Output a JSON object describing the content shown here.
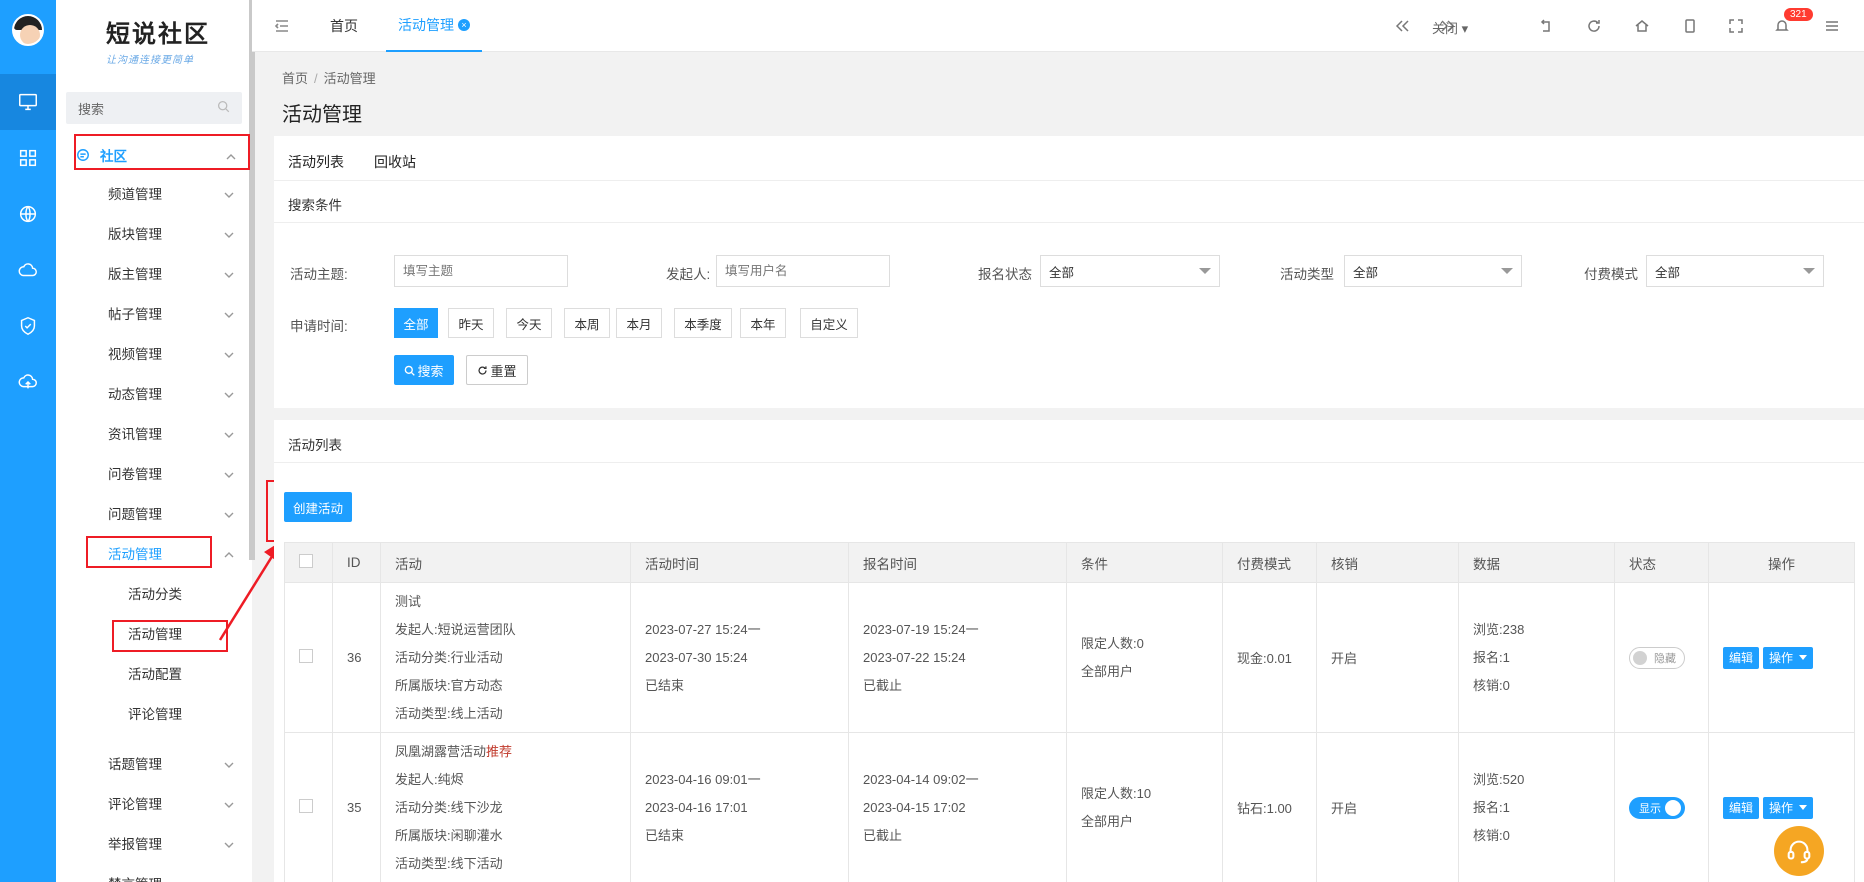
{
  "brand": {
    "title": "短说社区",
    "tagline": "让沟通连接更简单"
  },
  "sidebar": {
    "search_placeholder": "搜索",
    "top_menu": "社区",
    "items": [
      {
        "label": "频道管理"
      },
      {
        "label": "版块管理"
      },
      {
        "label": "版主管理"
      },
      {
        "label": "帖子管理"
      },
      {
        "label": "视频管理"
      },
      {
        "label": "动态管理"
      },
      {
        "label": "资讯管理"
      },
      {
        "label": "问卷管理"
      },
      {
        "label": "问题管理"
      },
      {
        "label": "活动管理"
      }
    ],
    "sub_items": [
      {
        "label": "活动分类"
      },
      {
        "label": "活动管理"
      },
      {
        "label": "活动配置"
      },
      {
        "label": "评论管理"
      }
    ],
    "more_items": [
      {
        "label": "话题管理"
      },
      {
        "label": "评论管理"
      },
      {
        "label": "举报管理"
      },
      {
        "label": "禁言管理"
      }
    ]
  },
  "topbar": {
    "tabs": [
      {
        "label": "首页"
      },
      {
        "label": "活动管理"
      }
    ],
    "close_label": "关闭",
    "notification_count": "321"
  },
  "breadcrumb": {
    "home": "首页",
    "sep": "/",
    "current": "活动管理"
  },
  "page_title": "活动管理",
  "content_tabs": [
    {
      "label": "活动列表"
    },
    {
      "label": "回收站"
    }
  ],
  "search_panel": {
    "title": "搜索条件",
    "topic_label": "活动主题:",
    "topic_placeholder": "填写主题",
    "initiator_label": "发起人:",
    "initiator_placeholder": "填写用户名",
    "signup_label": "报名状态",
    "signup_value": "全部",
    "type_label": "活动类型",
    "type_value": "全部",
    "pay_label": "付费模式",
    "pay_value": "全部",
    "time_label": "申请时间:",
    "time_options": [
      {
        "label": "全部"
      },
      {
        "label": "昨天"
      },
      {
        "label": "今天"
      },
      {
        "label": "本周"
      },
      {
        "label": "本月"
      },
      {
        "label": "本季度"
      },
      {
        "label": "本年"
      },
      {
        "label": "自定义"
      }
    ],
    "search_button": "搜索",
    "reset_button": "重置"
  },
  "list_panel": {
    "title": "活动列表",
    "create_button": "创建活动"
  },
  "table": {
    "headers": [
      {
        "label": ""
      },
      {
        "label": "ID"
      },
      {
        "label": "活动"
      },
      {
        "label": "活动时间"
      },
      {
        "label": "报名时间"
      },
      {
        "label": "条件"
      },
      {
        "label": "付费模式"
      },
      {
        "label": "核销"
      },
      {
        "label": "数据"
      },
      {
        "label": "状态"
      },
      {
        "label": "操作"
      }
    ],
    "rows": [
      {
        "id": "36",
        "name": "测试",
        "tag": "",
        "initiator": "发起人:短说运营团队",
        "category": "活动分类:行业活动",
        "section": "所属版块:官方动态",
        "type": "活动类型:线上活动",
        "time_start": "2023-07-27 15:24一",
        "time_end": "2023-07-30 15:24",
        "time_status": "已结束",
        "signup_start": "2023-07-19 15:24一",
        "signup_end": "2023-07-22 15:24",
        "signup_status": "已截止",
        "cond_limit": "限定人数:0",
        "cond_users": "全部用户",
        "pay": "现金:0.01",
        "verify": "开启",
        "views": "浏览:238",
        "signups": "报名:1",
        "verified": "核销:0",
        "status": "隐藏",
        "status_on": false,
        "edit": "编辑",
        "ops": "操作"
      },
      {
        "id": "35",
        "name": "凤凰湖露营活动",
        "tag": "推荐",
        "initiator": "发起人:纯烬",
        "category": "活动分类:线下沙龙",
        "section": "所属版块:闲聊灌水",
        "type": "活动类型:线下活动",
        "time_start": "2023-04-16 09:01一",
        "time_end": "2023-04-16 17:01",
        "time_status": "已结束",
        "signup_start": "2023-04-14 09:02一",
        "signup_end": "2023-04-15 17:02",
        "signup_status": "已截止",
        "cond_limit": "限定人数:10",
        "cond_users": "全部用户",
        "pay": "钻石:1.00",
        "verify": "开启",
        "views": "浏览:520",
        "signups": "报名:1",
        "verified": "核销:0",
        "status": "显示",
        "status_on": true,
        "edit": "编辑",
        "ops": "操作"
      }
    ]
  },
  "colors": {
    "accent": "#1e9fff",
    "annotation": "#ee1c25",
    "recommend": "#c0392b"
  }
}
